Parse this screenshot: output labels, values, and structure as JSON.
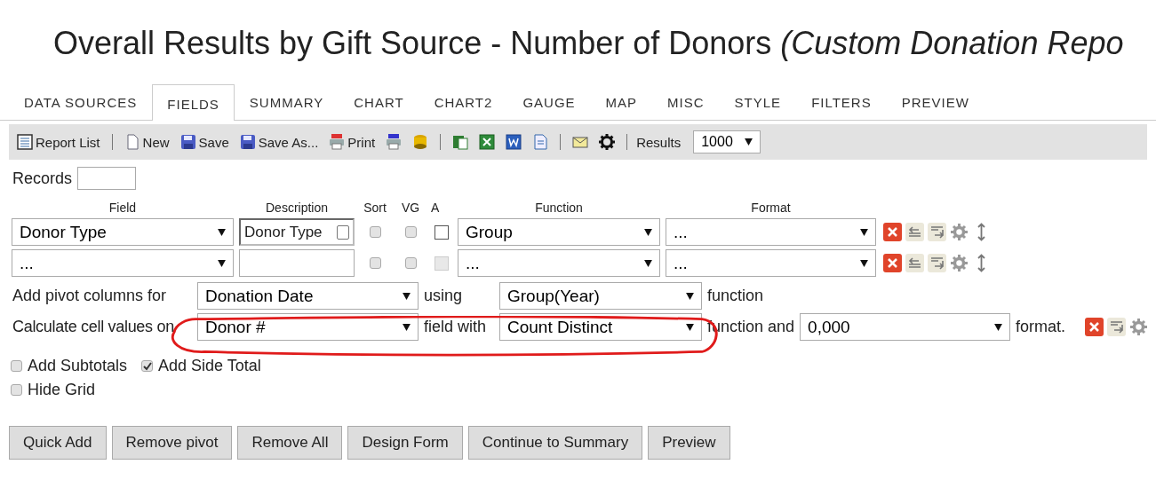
{
  "title": "Overall Results by Gift Source - Number of Donors *(Custom Donation Repo*",
  "tabs": [
    {
      "label": "DATA SOURCES",
      "selected": false
    },
    {
      "label": "FIELDS",
      "selected": true
    },
    {
      "label": "SUMMARY",
      "selected": false
    },
    {
      "label": "CHART",
      "selected": false
    },
    {
      "label": "CHART2",
      "selected": false
    },
    {
      "label": "GAUGE",
      "selected": false
    },
    {
      "label": "MAP",
      "selected": false
    },
    {
      "label": "MISC",
      "selected": false
    },
    {
      "label": "STYLE",
      "selected": false
    },
    {
      "label": "FILTERS",
      "selected": false
    },
    {
      "label": "PREVIEW",
      "selected": false
    }
  ],
  "toolbar": {
    "groups": [
      [
        {
          "kind": "labeled",
          "label": "Report List"
        }
      ],
      [
        {
          "kind": "labeled",
          "label": "New"
        },
        {
          "kind": "labeled",
          "label": "Save"
        },
        {
          "kind": "labeled",
          "label": "Save As..."
        },
        {
          "kind": "labeled",
          "label": "Print"
        },
        {
          "kind": "icon"
        },
        {
          "kind": "icon"
        }
      ],
      [
        {
          "kind": "icon"
        },
        {
          "kind": "icon"
        },
        {
          "kind": "icon"
        },
        {
          "kind": "icon"
        }
      ],
      [
        {
          "kind": "icon"
        },
        {
          "kind": "icon"
        }
      ]
    ],
    "results_label": "Results",
    "results_value": "1000"
  },
  "records": {
    "label": "Records"
  },
  "field_table": {
    "columns": [
      "Field",
      "Description",
      "Sort",
      "VG",
      "A",
      "Function",
      "Format"
    ],
    "rows": [
      {
        "field": "Donor Type",
        "description": "Donor Type",
        "sort_checked": false,
        "vg_checked": false,
        "a_checked": false,
        "a_disabled": false,
        "function": "Group",
        "format": "..."
      },
      {
        "field": "...",
        "sort_checked": false,
        "vg_checked": false,
        "a_checked": false,
        "a_disabled": true,
        "function": "...",
        "format": "..."
      }
    ]
  },
  "pivot": {
    "label": "Add pivot columns for",
    "field": "Donation Date",
    "using_label": "using",
    "function": "Group(Year)",
    "suffix": "function"
  },
  "cell_values": {
    "label": "Calculate cell values on",
    "field": "Donor #",
    "with_label": "field with",
    "function": "Count Distinct",
    "and_label": "function and",
    "format": "0,000",
    "suffix": "format."
  },
  "options": [
    {
      "label": "Add Subtotals",
      "checked": false
    },
    {
      "label": "Add Side Total",
      "checked": true
    },
    {
      "label": "Hide Grid",
      "checked": false
    }
  ],
  "buttons": [
    "Quick Add",
    "Remove pivot",
    "Remove All",
    "Design Form",
    "Continue to Summary",
    "Preview"
  ]
}
